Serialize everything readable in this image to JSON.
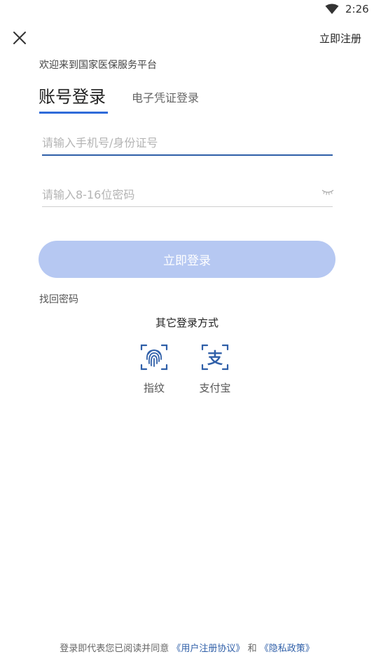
{
  "status_bar": {
    "time": "2:26",
    "wifi_icon": "wifi-icon"
  },
  "header": {
    "close_icon": "close-icon",
    "register_label": "立即注册"
  },
  "welcome_text": "欢迎来到国家医保服务平台",
  "tabs": [
    {
      "label": "账号登录",
      "active": true
    },
    {
      "label": "电子凭证登录",
      "active": false
    }
  ],
  "form": {
    "phone_placeholder": "请输入手机号/身份证号",
    "phone_value": "",
    "password_placeholder": "请输入8-16位密码",
    "password_value": "",
    "password_toggle_icon": "eye-closed-icon"
  },
  "login_button": "立即登录",
  "forgot_password": "找回密码",
  "other_login": {
    "title": "其它登录方式",
    "methods": [
      {
        "label": "指纹",
        "icon": "fingerprint-icon"
      },
      {
        "label": "支付宝",
        "icon": "alipay-icon"
      }
    ]
  },
  "footer": {
    "prefix": "登录即代表您已阅读并同意",
    "agreement": "《用户注册协议》",
    "and": "和",
    "privacy": "《隐私政策》"
  },
  "colors": {
    "accent": "#2f6bd9",
    "button_disabled": "#b6c8f2",
    "link": "#2f5fa8"
  }
}
